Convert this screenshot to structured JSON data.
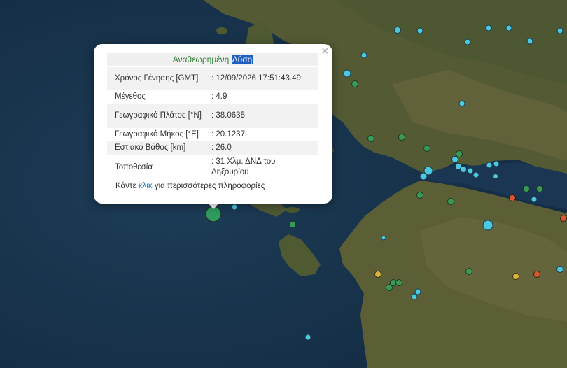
{
  "popup": {
    "close_label": "×",
    "title_prefix": "Αναθεωρημένη",
    "title_highlight": "Λύση",
    "rows": [
      {
        "label": "Χρόνος Γένησης [GMT]",
        "value": ": 12/09/2026 17:51:43.49"
      },
      {
        "label": "Μέγεθος",
        "value": ": 4.9"
      },
      {
        "label": "Γεωγραφικό Πλάτος [°N]",
        "value": ": 38.0635"
      },
      {
        "label": "Γεωγραφικό Μήκος [°E]",
        "value": ": 20.1237"
      },
      {
        "label": "Εστιακό Βάθος [km]",
        "value": ": 26.0"
      },
      {
        "label": "Τοποθεσία",
        "value": ": 31 Χλμ. ΔΝΔ του Ληξουρίου"
      }
    ],
    "more_prefix": "Κάντε",
    "more_link": "κλικ",
    "more_suffix": "για περισσότερες πληροφορίες"
  },
  "colors": {
    "sea": "#183450",
    "land": "#5a5e38",
    "marker_cyan": "#4cc9e0",
    "marker_green": "#3a9a55",
    "marker_orange": "#d9582b",
    "marker_yellow": "#d8b43a",
    "selected_event": "#2f9a5e"
  }
}
